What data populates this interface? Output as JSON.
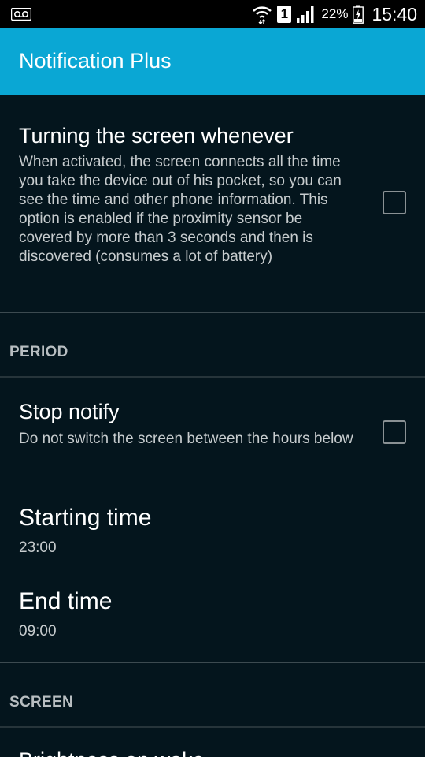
{
  "status_bar": {
    "battery_percent": "22%",
    "clock": "15:40",
    "sim_slot": "1",
    "icons": [
      "voicemail-icon",
      "wifi-icon",
      "signal-icon",
      "battery-charging-icon"
    ]
  },
  "app_bar": {
    "title": "Notification Plus",
    "color": "#0aa7d4"
  },
  "prefs": {
    "screen_on": {
      "title": "Turning the screen whenever",
      "summary": "When activated, the screen connects all the time you take the device out of his pocket, so you can see the time and other phone information. This option is enabled if the proximity sensor be covered by more than 3 seconds and then is discovered (consumes a lot of battery)",
      "checked": false
    },
    "period_category": "PERIOD",
    "stop_notify": {
      "title": "Stop notify",
      "summary": "Do not switch the screen between the hours below",
      "checked": false
    },
    "starting_time": {
      "title": "Starting time",
      "value": "23:00"
    },
    "end_time": {
      "title": "End time",
      "value": "09:00"
    },
    "screen_category": "SCREEN",
    "brightness": {
      "title": "Brightness on wake"
    }
  }
}
